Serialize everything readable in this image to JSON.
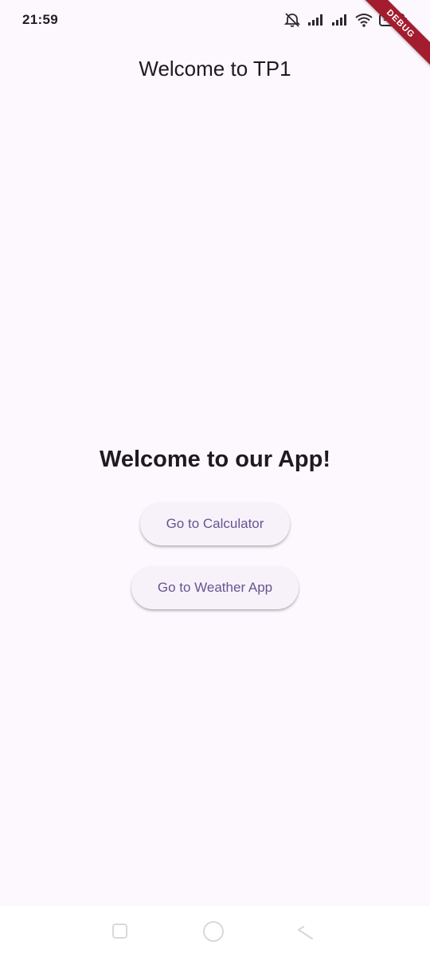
{
  "status_bar": {
    "time": "21:59",
    "battery": "98",
    "icons": [
      "mute-icon",
      "signal-icon",
      "signal-icon",
      "wifi-icon",
      "battery-icon"
    ]
  },
  "debug_banner": "DEBUG",
  "app_bar": {
    "title": "Welcome to TP1"
  },
  "main": {
    "heading": "Welcome to our App!",
    "calculator_button": "Go to Calculator",
    "weather_button": "Go to Weather App"
  },
  "nav_bar": {
    "icons": [
      "recent-apps-icon",
      "home-icon",
      "back-icon"
    ]
  },
  "colors": {
    "background": "#fdf7fe",
    "button_bg": "#f7f2fa",
    "button_text": "#65558f",
    "debug_banner": "#a31d2f"
  }
}
